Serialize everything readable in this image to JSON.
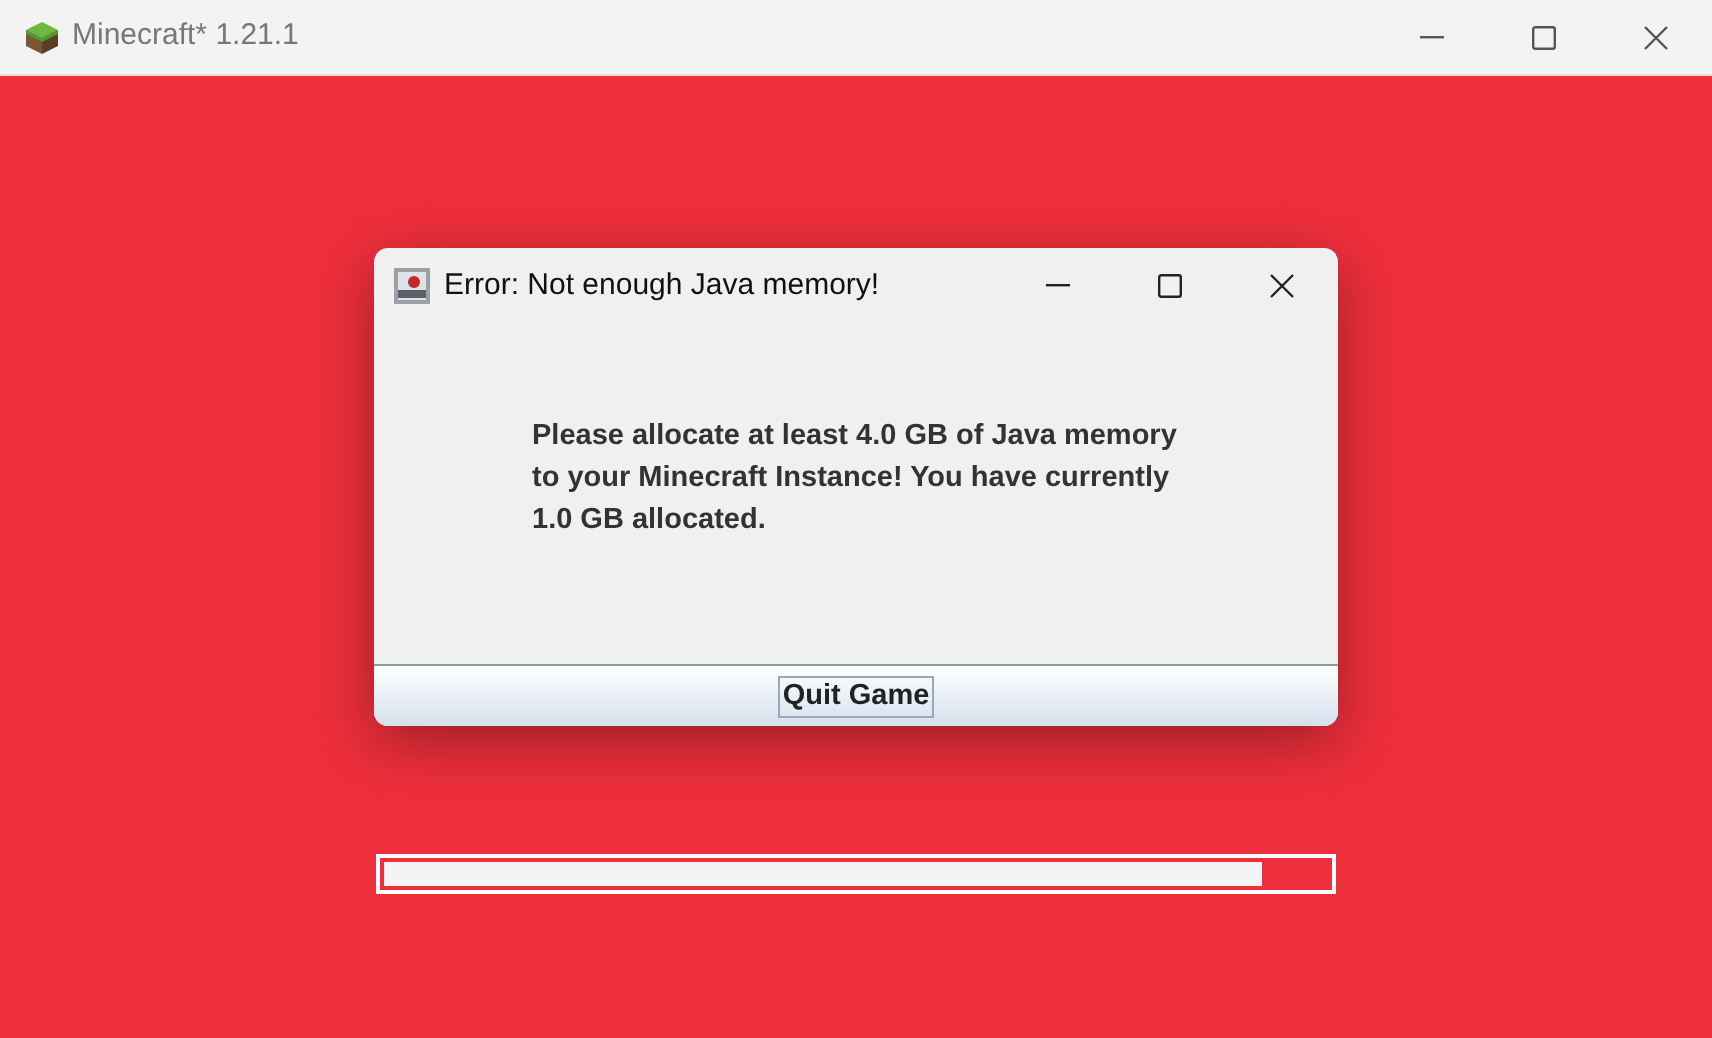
{
  "window": {
    "title": "Minecraft* 1.21.1"
  },
  "dialog": {
    "title": "Error: Not enough Java memory!",
    "message": "Please allocate at least 4.0 GB of Java memory to your Minecraft Instance! You have currently 1.0 GB allocated.",
    "button": "Quit Game"
  },
  "progress": {
    "level": 0.93
  }
}
